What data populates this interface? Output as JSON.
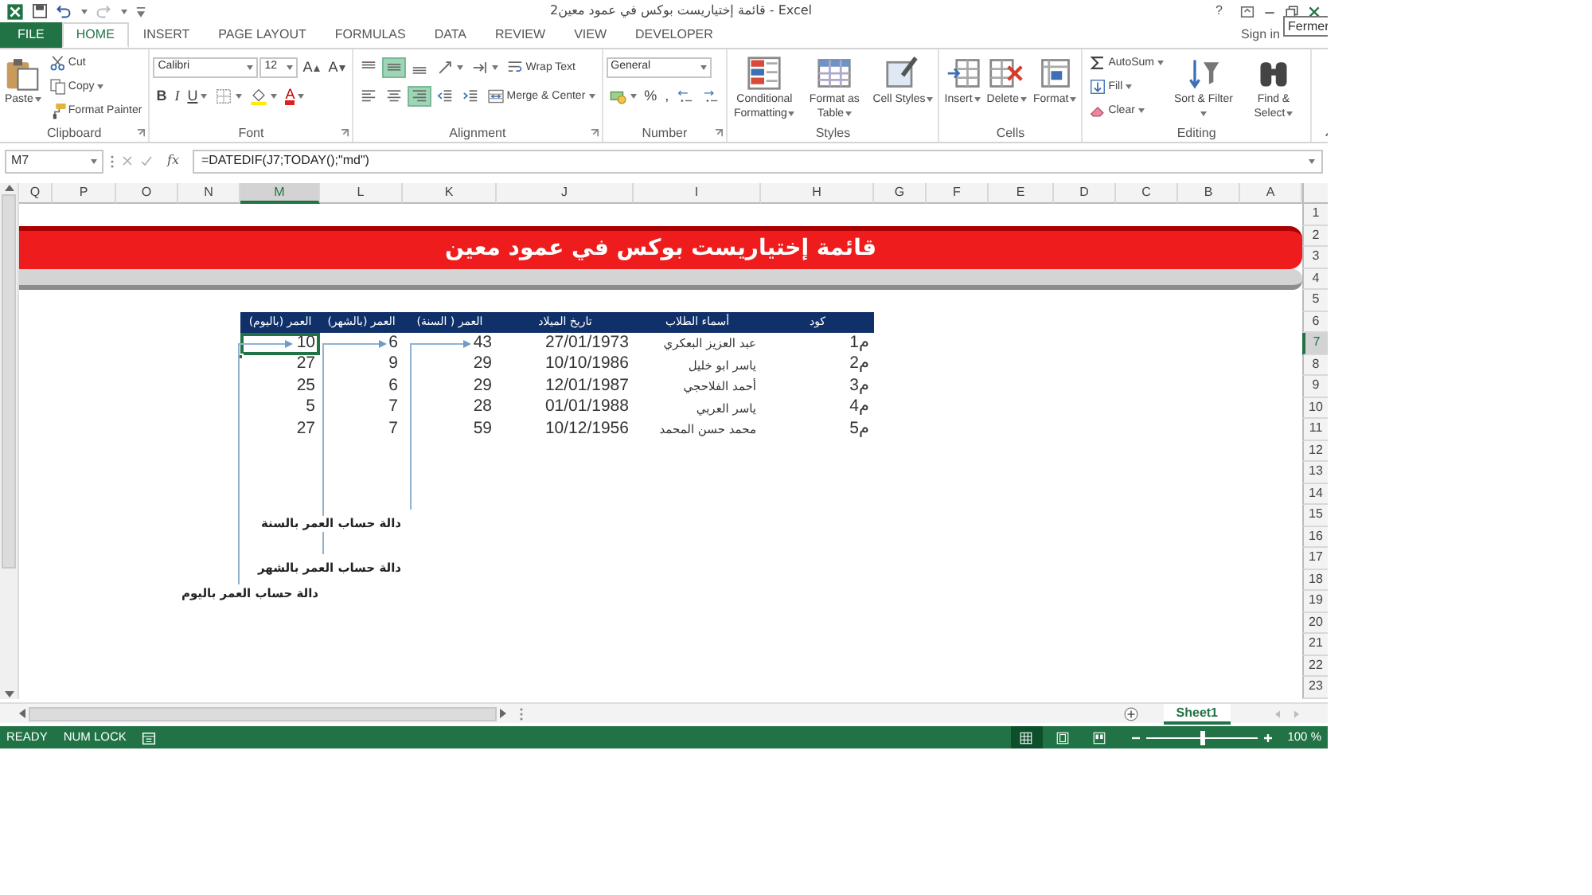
{
  "window": {
    "title": "قائمة إختياريست بوكس في عمود معين2 - Excel",
    "help": "?",
    "account": "Sign in",
    "tooltip": "Fermer"
  },
  "ribbon_tabs": [
    {
      "label": "FILE",
      "kind": "file",
      "selected": false
    },
    {
      "label": "HOME",
      "kind": "tab",
      "selected": true
    },
    {
      "label": "INSERT",
      "kind": "tab",
      "selected": false
    },
    {
      "label": "PAGE LAYOUT",
      "kind": "tab",
      "selected": false
    },
    {
      "label": "FORMULAS",
      "kind": "tab",
      "selected": false
    },
    {
      "label": "DATA",
      "kind": "tab",
      "selected": false
    },
    {
      "label": "REVIEW",
      "kind": "tab",
      "selected": false
    },
    {
      "label": "VIEW",
      "kind": "tab",
      "selected": false
    },
    {
      "label": "DEVELOPER",
      "kind": "tab",
      "selected": false
    }
  ],
  "ribbon_groups": [
    {
      "label": "Clipboard",
      "launcher": true,
      "parts": [
        {
          "kind": "large",
          "label": "Paste",
          "dropdown": true
        },
        {
          "kind": "stack",
          "items": [
            {
              "kind": "small",
              "label": "Cut"
            },
            {
              "kind": "small",
              "label": "Copy",
              "dropdown": true
            },
            {
              "kind": "small",
              "label": "Format Painter"
            }
          ]
        }
      ]
    },
    {
      "label": "Font",
      "launcher": true,
      "parts": [
        {
          "kind": "lines",
          "lines": [
            {
              "items": [
                {
                  "kind": "combo",
                  "value": "Calibri"
                },
                {
                  "kind": "combo",
                  "value": "12"
                },
                {
                  "kind": "grow",
                  "label": "A"
                },
                {
                  "kind": "shrink",
                  "label": "A"
                }
              ]
            },
            {
              "items": [
                {
                  "kind": "bold",
                  "label": "B"
                },
                {
                  "kind": "italic",
                  "label": "I"
                },
                {
                  "kind": "underline",
                  "label": "U",
                  "dropdown": true
                },
                {
                  "kind": "icon",
                  "dropdown": true
                },
                {
                  "kind": "icon",
                  "dropdown": true
                },
                {
                  "kind": "fontcolor",
                  "label": "A",
                  "dropdown": true
                }
              ]
            }
          ]
        }
      ]
    },
    {
      "label": "Alignment",
      "launcher": true,
      "parts": [
        {
          "kind": "lines",
          "lines": [
            {
              "items": [
                {
                  "kind": "icon",
                  "selected": false
                },
                {
                  "kind": "icon",
                  "selected": true
                },
                {
                  "kind": "icon",
                  "selected": false
                },
                {
                  "kind": "icon",
                  "dropdown": true
                },
                {
                  "kind": "icon",
                  "dropdown": true
                },
                {
                  "kind": "small",
                  "label": "Wrap Text"
                }
              ]
            },
            {
              "items": [
                {
                  "kind": "icon",
                  "selected": false
                },
                {
                  "kind": "icon",
                  "selected": false
                },
                {
                  "kind": "icon",
                  "selected": true
                },
                {
                  "kind": "icon"
                },
                {
                  "kind": "icon"
                },
                {
                  "kind": "small",
                  "label": "Merge & Center",
                  "dropdown": true
                }
              ]
            }
          ]
        }
      ]
    },
    {
      "label": "Number",
      "launcher": true,
      "parts": [
        {
          "kind": "lines",
          "lines": [
            {
              "items": [
                {
                  "kind": "combo",
                  "value": "General"
                }
              ]
            },
            {
              "items": [
                {
                  "kind": "icon",
                  "dropdown": true
                },
                {
                  "kind": "text",
                  "label": "%"
                },
                {
                  "kind": "text",
                  "label": ","
                },
                {
                  "kind": "icon"
                },
                {
                  "kind": "icon"
                }
              ]
            }
          ]
        }
      ]
    },
    {
      "label": "Styles",
      "launcher": false,
      "parts": [
        {
          "kind": "large",
          "label": "Conditional Formatting",
          "dropdown": true
        },
        {
          "kind": "large",
          "label": "Format as Table",
          "dropdown": true
        },
        {
          "kind": "large",
          "label": "Cell Styles",
          "dropdown": true
        }
      ]
    },
    {
      "label": "Cells",
      "launcher": false,
      "parts": [
        {
          "kind": "large",
          "label": "Insert",
          "dropdown": true
        },
        {
          "kind": "large",
          "label": "Delete",
          "dropdown": true
        },
        {
          "kind": "large",
          "label": "Format",
          "dropdown": true
        }
      ]
    },
    {
      "label": "Editing",
      "launcher": false,
      "parts": [
        {
          "kind": "stack",
          "items": [
            {
              "kind": "small",
              "label": "AutoSum",
              "dropdown": true
            },
            {
              "kind": "small",
              "label": "Fill",
              "dropdown": true
            },
            {
              "kind": "small",
              "label": "Clear",
              "dropdown": true
            }
          ]
        },
        {
          "kind": "large",
          "label": "Sort & Filter",
          "dropdown": true
        },
        {
          "kind": "large",
          "label": "Find & Select",
          "dropdown": true
        }
      ]
    }
  ],
  "formula_bar": {
    "name_box": "M7",
    "function_label": "fx",
    "formula": "=DATEDIF(J7;TODAY();\"md\")"
  },
  "sheet": {
    "columns": [
      {
        "label": "Q",
        "selected": false
      },
      {
        "label": "P",
        "selected": false
      },
      {
        "label": "O",
        "selected": false
      },
      {
        "label": "N",
        "selected": false
      },
      {
        "label": "M",
        "selected": true
      },
      {
        "label": "L",
        "selected": false
      },
      {
        "label": "K",
        "selected": false
      },
      {
        "label": "J",
        "selected": false
      },
      {
        "label": "I",
        "selected": false
      },
      {
        "label": "H",
        "selected": false
      },
      {
        "label": "G",
        "selected": false
      },
      {
        "label": "F",
        "selected": false
      },
      {
        "label": "E",
        "selected": false
      },
      {
        "label": "D",
        "selected": false
      },
      {
        "label": "C",
        "selected": false
      },
      {
        "label": "B",
        "selected": false
      },
      {
        "label": "A",
        "selected": false
      }
    ],
    "rows": [
      {
        "label": "1",
        "selected": false
      },
      {
        "label": "2",
        "selected": false
      },
      {
        "label": "3",
        "selected": false
      },
      {
        "label": "4",
        "selected": false
      },
      {
        "label": "5",
        "selected": false
      },
      {
        "label": "6",
        "selected": false
      },
      {
        "label": "7",
        "selected": true
      },
      {
        "label": "8",
        "selected": false
      },
      {
        "label": "9",
        "selected": false
      },
      {
        "label": "10",
        "selected": false
      },
      {
        "label": "11",
        "selected": false
      },
      {
        "label": "12",
        "selected": false
      },
      {
        "label": "13",
        "selected": false
      },
      {
        "label": "14",
        "selected": false
      },
      {
        "label": "15",
        "selected": false
      },
      {
        "label": "16",
        "selected": false
      },
      {
        "label": "17",
        "selected": false
      },
      {
        "label": "18",
        "selected": false
      },
      {
        "label": "19",
        "selected": false
      },
      {
        "label": "20",
        "selected": false
      },
      {
        "label": "21",
        "selected": false
      },
      {
        "label": "22",
        "selected": false
      },
      {
        "label": "23",
        "selected": false
      }
    ],
    "banner": {
      "title": "قائمة إختياريست بوكس في عمود معين"
    },
    "table": {
      "columns": [
        "العمر (باليوم)",
        "العمر (بالشهر)",
        "العمر ( السنة)",
        "تاريخ الميلاد",
        "أسماء الطلاب",
        "كود"
      ],
      "rows": [
        [
          {
            "text": "10",
            "selected": true
          },
          {
            "text": "6",
            "selected": false
          },
          {
            "text": "43",
            "selected": false
          },
          {
            "text": "27/01/1973",
            "selected": false
          },
          {
            "text": "عبد العزيز البعكري",
            "selected": false
          },
          {
            "text": "م1",
            "selected": false
          }
        ],
        [
          {
            "text": "27",
            "selected": false
          },
          {
            "text": "9",
            "selected": false
          },
          {
            "text": "29",
            "selected": false
          },
          {
            "text": "10/10/1986",
            "selected": false
          },
          {
            "text": "ياسر ابو خليل",
            "selected": false
          },
          {
            "text": "م2",
            "selected": false
          }
        ],
        [
          {
            "text": "25",
            "selected": false
          },
          {
            "text": "6",
            "selected": false
          },
          {
            "text": "29",
            "selected": false
          },
          {
            "text": "12/01/1987",
            "selected": false
          },
          {
            "text": "أحمد الفلاحجي",
            "selected": false
          },
          {
            "text": "م3",
            "selected": false
          }
        ],
        [
          {
            "text": "5",
            "selected": false
          },
          {
            "text": "7",
            "selected": false
          },
          {
            "text": "28",
            "selected": false
          },
          {
            "text": "01/01/1988",
            "selected": false
          },
          {
            "text": "ياسر العربي",
            "selected": false
          },
          {
            "text": "م4",
            "selected": false
          }
        ],
        [
          {
            "text": "27",
            "selected": false
          },
          {
            "text": "7",
            "selected": false
          },
          {
            "text": "59",
            "selected": false
          },
          {
            "text": "10/12/1956",
            "selected": false
          },
          {
            "text": "محمد حسن المحمد",
            "selected": false
          },
          {
            "text": "م5",
            "selected": false
          }
        ]
      ]
    },
    "annotations": [
      {
        "text": "دالة حساب العمر بالسنة"
      },
      {
        "text": "دالة حساب العمر بالشهر"
      },
      {
        "text": "دالة حساب العمر باليوم"
      }
    ]
  },
  "sheet_tabs": [
    {
      "label": "Sheet1",
      "selected": true
    }
  ],
  "status_bar": {
    "mode": "READY",
    "indicators": [
      "NUM LOCK"
    ],
    "views": [
      {
        "selected": true
      },
      {
        "selected": false
      },
      {
        "selected": false
      }
    ],
    "zoom": {
      "level": 0.5,
      "reading": "100 %"
    }
  }
}
